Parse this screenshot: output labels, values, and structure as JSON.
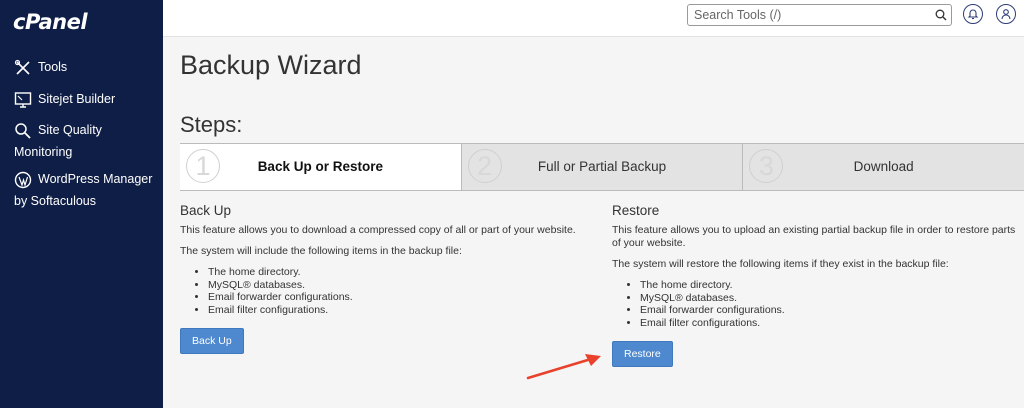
{
  "sidebar": {
    "logo": "cPanel",
    "items": [
      {
        "label": "Tools",
        "icon": "tools-icon"
      },
      {
        "label": "Sitejet Builder",
        "icon": "monitor-icon"
      },
      {
        "label": "Site Quality",
        "label2": "Monitoring",
        "icon": "magnifier-icon"
      },
      {
        "label": "WordPress Manager",
        "label2": "by Softaculous",
        "icon": "wordpress-icon"
      }
    ]
  },
  "header": {
    "search_placeholder": "Search Tools (/)"
  },
  "main": {
    "title": "Backup Wizard",
    "steps_title": "Steps:",
    "steps": [
      {
        "number": "1",
        "label": "Back Up or Restore"
      },
      {
        "number": "2",
        "label": "Full or Partial Backup"
      },
      {
        "number": "3",
        "label": "Download"
      }
    ],
    "backup": {
      "heading": "Back Up",
      "desc": "This feature allows you to download a compressed copy of all or part of your website.",
      "intro": "The system will include the following items in the backup file:",
      "items": [
        "The home directory.",
        "MySQL® databases.",
        "Email forwarder configurations.",
        "Email filter configurations."
      ],
      "button": "Back Up"
    },
    "restore": {
      "heading": "Restore",
      "desc": "This feature allows you to upload an existing partial backup file in order to restore parts of your website.",
      "intro": "The system will restore the following items if they exist in the backup file:",
      "items": [
        "The home directory.",
        "MySQL® databases.",
        "Email forwarder configurations.",
        "Email filter configurations."
      ],
      "button": "Restore"
    }
  },
  "colors": {
    "sidebar_bg": "#0f1e46",
    "button_bg": "#4e88ce",
    "arrow": "#e8412c"
  }
}
